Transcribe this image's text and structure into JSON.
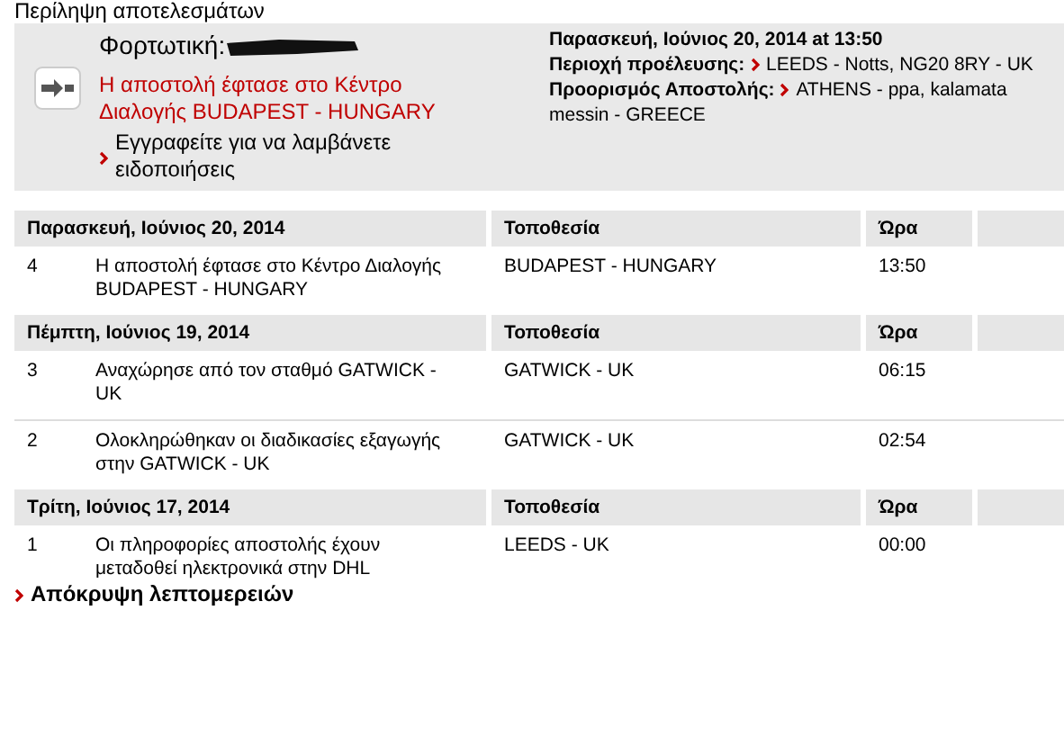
{
  "page_title": "Περίληψη αποτελεσμάτων",
  "summary": {
    "waybill_label": "Φορτωτική:",
    "status": "Η αποστολή έφτασε στο Κέντρο Διαλογής BUDAPEST - HUNGARY",
    "subscribe_link": "Εγγραφείτε για να λαμβάνετε ειδοποιήσεις",
    "datetime": "Παρασκευή, Ιούνιος 20, 2014 at 13:50",
    "origin_label": "Περιοχή προέλευσης:",
    "origin": "LEEDS - Notts, NG20 8RY - UK",
    "destination_label": "Προορισμός Αποστολής:",
    "destination": "ATHENS - ppa, kalamata messin - GREECE"
  },
  "groups": [
    {
      "date": "Παρασκευή, Ιούνιος 20, 2014",
      "location_header": "Τοποθεσία",
      "time_header": "Ώρα",
      "rows": [
        {
          "number": "4",
          "description": "Η αποστολή έφτασε στο Κέντρο Διαλογής BUDAPEST - HUNGARY",
          "location": "BUDAPEST - HUNGARY",
          "time": "13:50"
        }
      ]
    },
    {
      "date": "Πέμπτη, Ιούνιος 19, 2014",
      "location_header": "Τοποθεσία",
      "time_header": "Ώρα",
      "rows": [
        {
          "number": "3",
          "description": "Αναχώρησε από τον σταθμό GATWICK - UK",
          "location": "GATWICK - UK",
          "time": "06:15"
        },
        {
          "number": "2",
          "description": "Ολοκληρώθηκαν οι διαδικασίες εξαγωγής στην GATWICK - UK",
          "location": "GATWICK - UK",
          "time": "02:54"
        }
      ]
    },
    {
      "date": "Τρίτη, Ιούνιος 17, 2014",
      "location_header": "Τοποθεσία",
      "time_header": "Ώρα",
      "rows": [
        {
          "number": "1",
          "description": "Οι πληροφορίες αποστολής έχουν μεταδοθεί ηλεκτρονικά στην DHL",
          "location": "LEEDS - UK",
          "time": "00:00"
        }
      ]
    }
  ],
  "hide_details_link": "Απόκρυψη λεπτομερειών"
}
